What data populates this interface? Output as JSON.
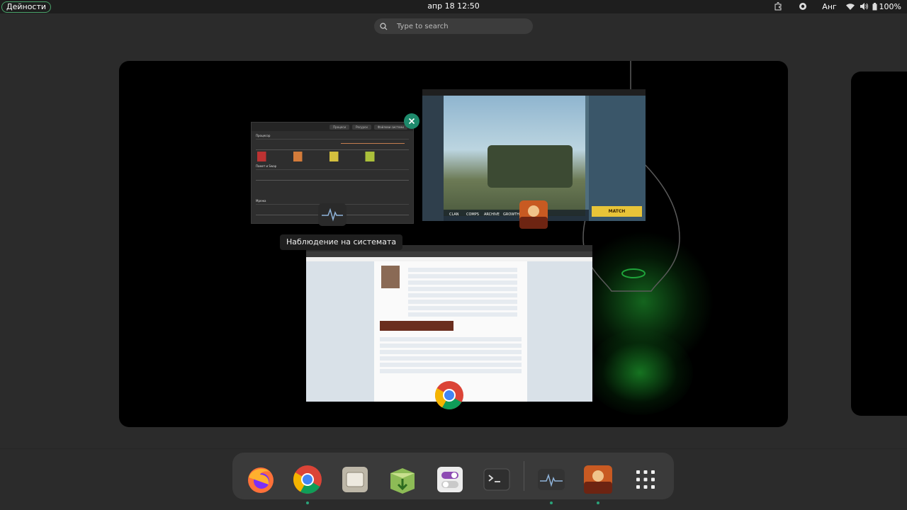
{
  "topbar": {
    "activities_label": "Дейности",
    "clock": "апр 18  12:50",
    "keyboard_layout": "Анг",
    "battery_percent": "100%"
  },
  "search": {
    "placeholder": "Type to search"
  },
  "windows": {
    "system_monitor": {
      "tooltip": "Наблюдение на системата",
      "tabs": [
        "Процеси",
        "Ресурси",
        "Файлови системи"
      ],
      "sections": [
        "Процесор",
        "Памет и Swap",
        "Мрежа"
      ]
    },
    "game": {
      "match_label": "MATCH",
      "bottom_tabs": [
        "CLAN",
        "COMPS",
        "ARCHIVE",
        "GROWTH"
      ]
    },
    "browser": {}
  },
  "dock": {
    "items": [
      {
        "name": "firefox",
        "running": false
      },
      {
        "name": "chrome",
        "running": true
      },
      {
        "name": "files",
        "running": false
      },
      {
        "name": "software-installer",
        "running": false
      },
      {
        "name": "settings-toggle",
        "running": false
      },
      {
        "name": "terminal",
        "running": false
      },
      {
        "name": "system-monitor",
        "running": true
      },
      {
        "name": "pubg-game",
        "running": true
      },
      {
        "name": "app-grid",
        "running": false
      }
    ]
  },
  "colors": {
    "accent": "#2aa37a",
    "topbar_bg": "#1e1e1e",
    "overview_bg": "#2b2b2b",
    "dock_bg": "#3a3a3a"
  }
}
